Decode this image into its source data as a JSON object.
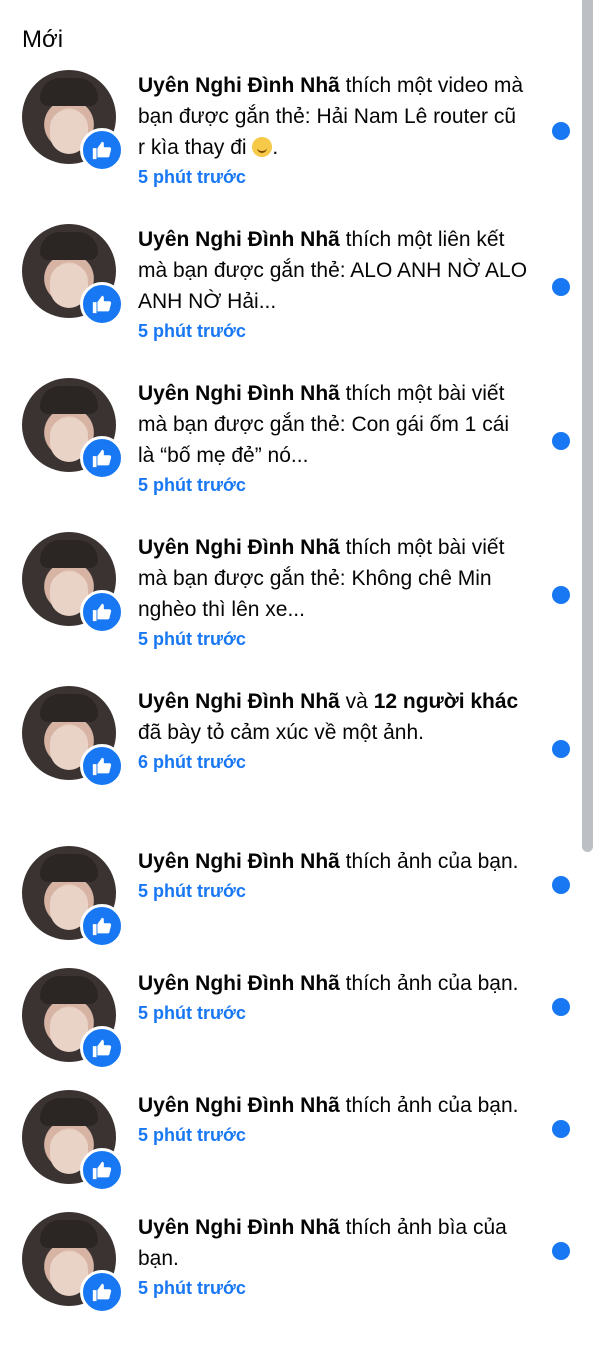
{
  "section": {
    "title": "Mới"
  },
  "notifications": [
    {
      "name": "Uyên Nghi Đình Nhã",
      "action_pre": " thích một video mà bạn được gắn thẻ: Hải Nam Lê router cũ r kìa thay đi ",
      "bold2": "",
      "action_post": ".",
      "time": "5 phút trước",
      "has_emoji": true
    },
    {
      "name": "Uyên Nghi Đình Nhã",
      "action_pre": " thích một liên kết mà bạn được gắn thẻ: ALO ANH NỜ ALO ANH NỜ Hải...",
      "bold2": "",
      "action_post": "",
      "time": "5 phút trước",
      "has_emoji": false
    },
    {
      "name": "Uyên Nghi Đình Nhã",
      "action_pre": " thích một bài viết mà bạn được gắn thẻ: Con gái ốm 1 cái là “bố mẹ đẻ” nó...",
      "bold2": "",
      "action_post": "",
      "time": "5 phút trước",
      "has_emoji": false
    },
    {
      "name": "Uyên Nghi Đình Nhã",
      "action_pre": " thích một bài viết mà bạn được gắn thẻ: Không chê Min nghèo thì lên xe...",
      "bold2": "",
      "action_post": "",
      "time": "5 phút trước",
      "has_emoji": false
    },
    {
      "name": "Uyên Nghi Đình Nhã",
      "action_pre": " và ",
      "bold2": "12 người khác",
      "action_post": " đã bày tỏ cảm xúc về một ảnh.",
      "time": "6 phút trước",
      "has_emoji": false
    },
    {
      "name": "Uyên Nghi Đình Nhã",
      "action_pre": " thích ảnh của bạn.",
      "bold2": "",
      "action_post": "",
      "time": "5 phút trước",
      "has_emoji": false
    },
    {
      "name": "Uyên Nghi Đình Nhã",
      "action_pre": " thích ảnh của bạn.",
      "bold2": "",
      "action_post": "",
      "time": "5 phút trước",
      "has_emoji": false
    },
    {
      "name": "Uyên Nghi Đình Nhã",
      "action_pre": " thích ảnh của bạn.",
      "bold2": "",
      "action_post": "",
      "time": "5 phút trước",
      "has_emoji": false
    },
    {
      "name": "Uyên Nghi Đình Nhã",
      "action_pre": " thích ảnh bìa của bạn.",
      "bold2": "",
      "action_post": "",
      "time": "5 phút trước",
      "has_emoji": false
    }
  ],
  "colors": {
    "accent": "#1877f2",
    "text": "#050505"
  },
  "icons": {
    "badge": "like-thumb-icon",
    "unread": "unread-dot-icon"
  }
}
